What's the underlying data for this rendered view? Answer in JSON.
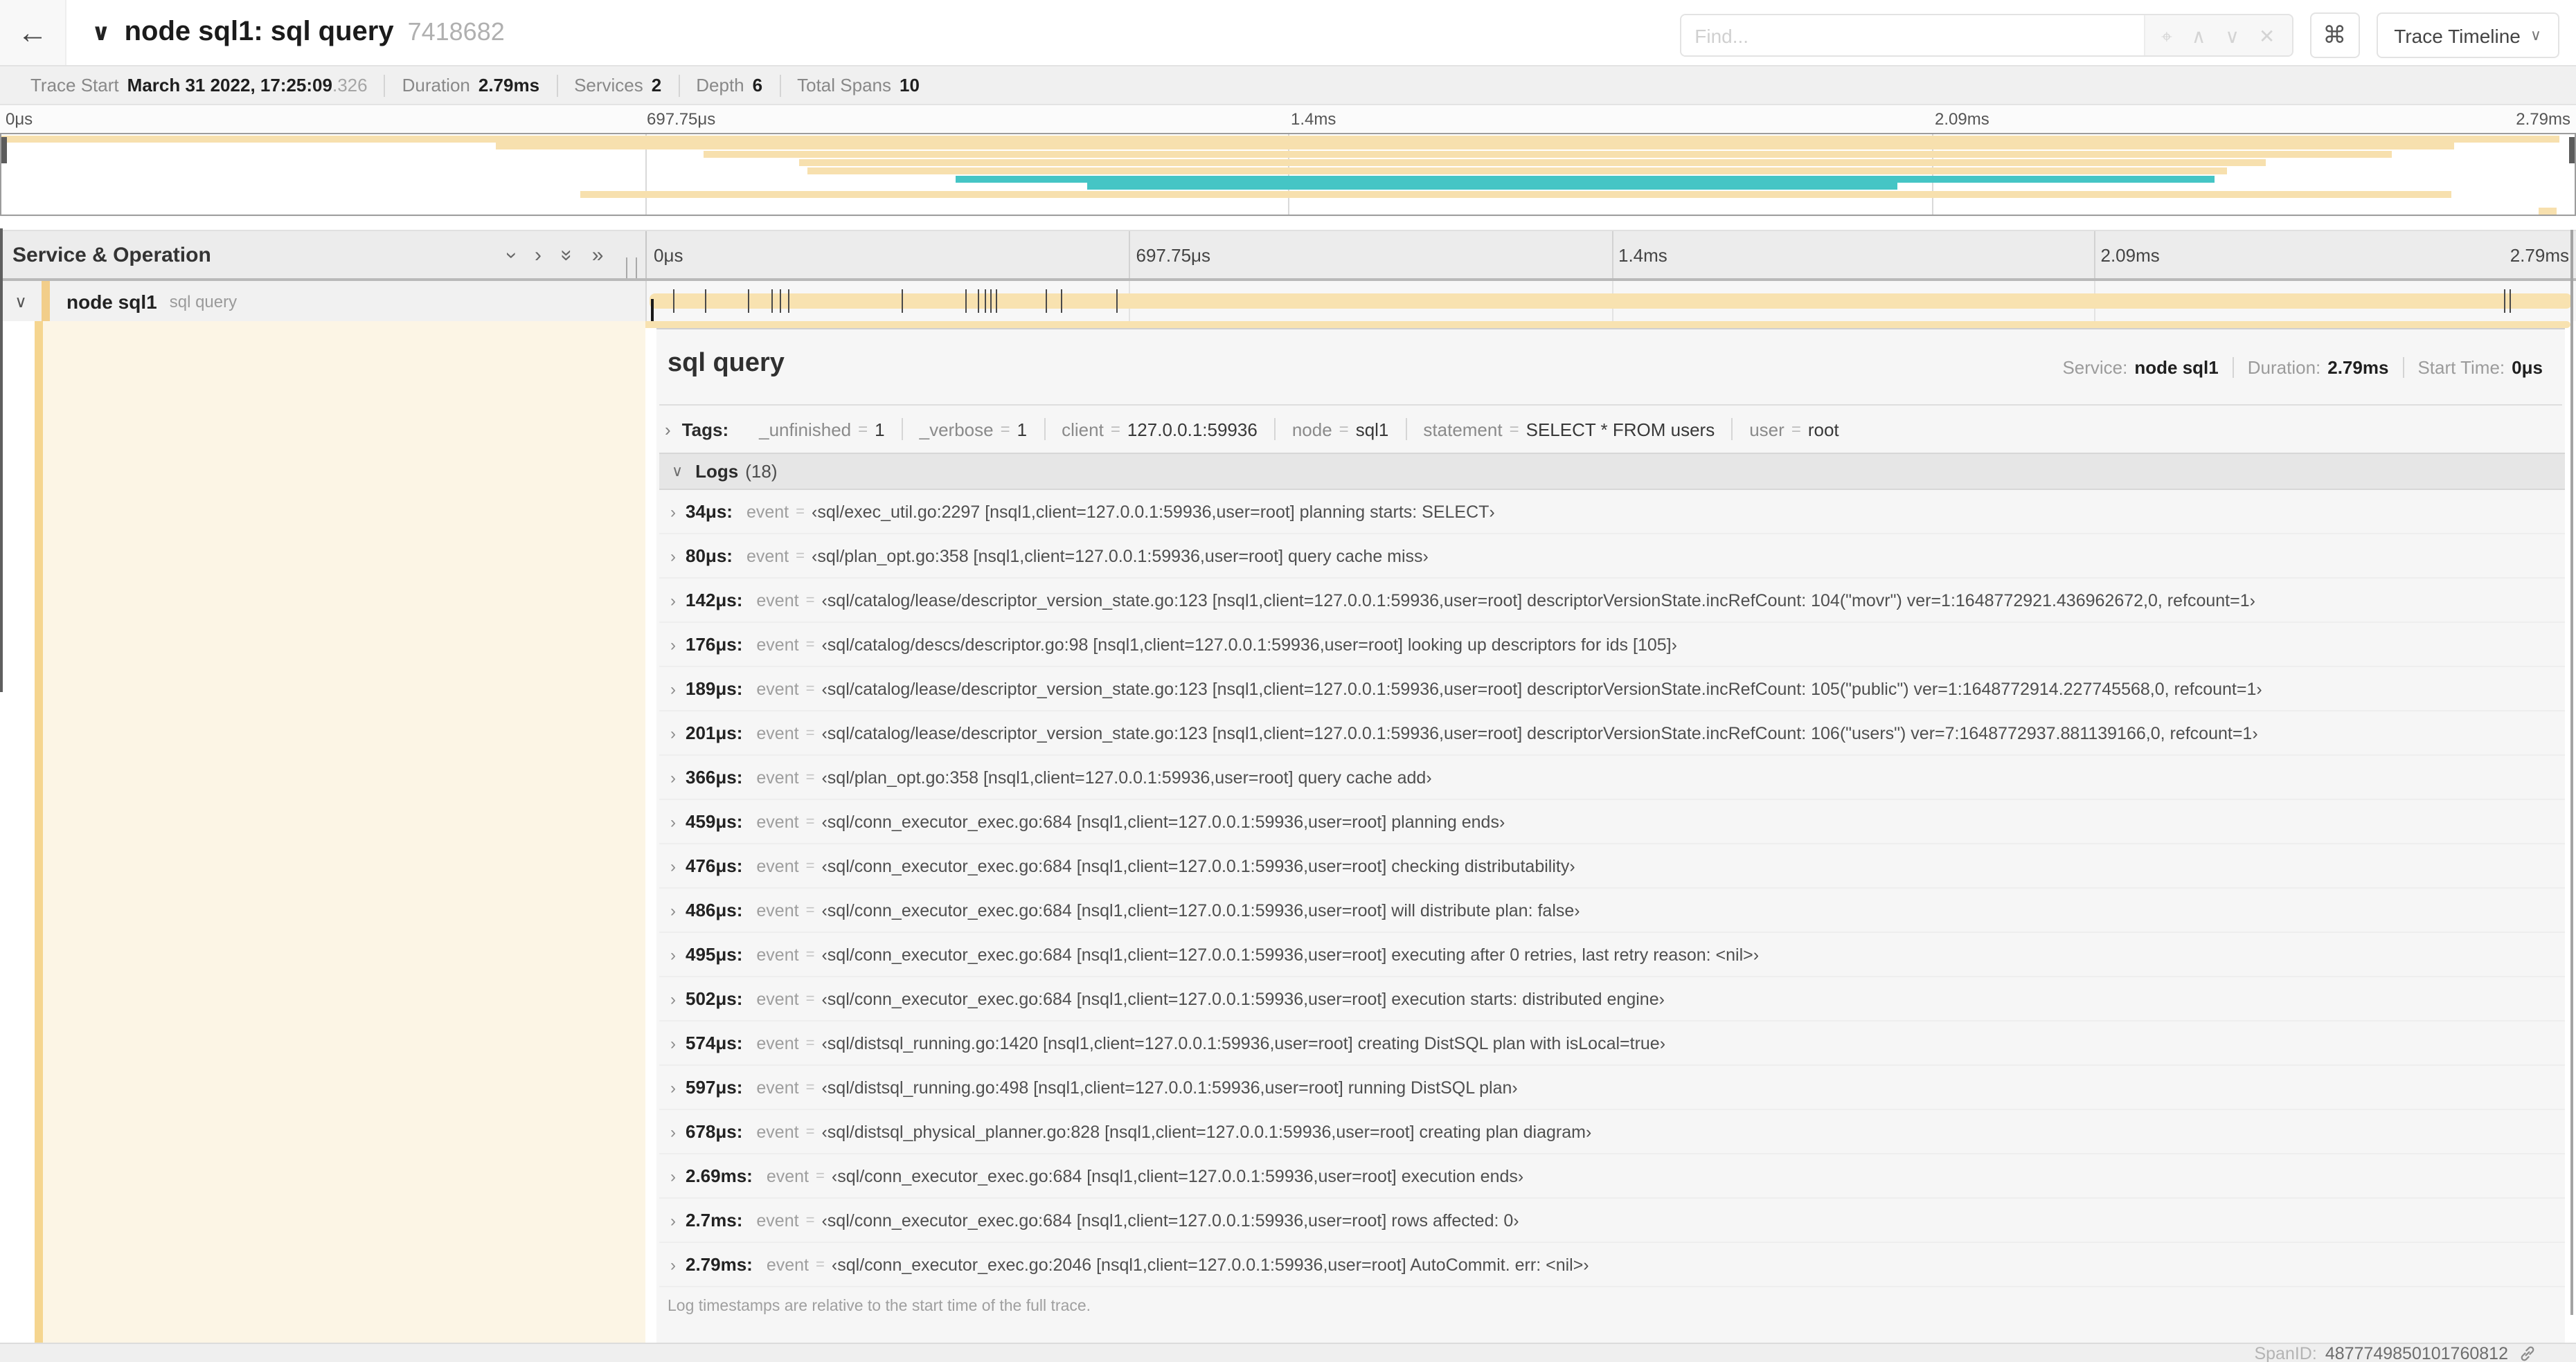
{
  "header": {
    "back_icon": "←",
    "collapse_icon": "∨",
    "title": "node sql1: sql query",
    "trace_id": "7418682",
    "find_placeholder": "Find...",
    "shortcut_button": "⌘",
    "view_select_label": "Trace Timeline",
    "view_select_chevron": "∨"
  },
  "summary": {
    "items": [
      {
        "label": "Trace Start",
        "value": "March 31 2022, 17:25:09",
        "suffix": ".326"
      },
      {
        "label": "Duration",
        "value": "2.79ms"
      },
      {
        "label": "Services",
        "value": "2"
      },
      {
        "label": "Depth",
        "value": "6"
      },
      {
        "label": "Total Spans",
        "value": "10"
      }
    ]
  },
  "minimap": {
    "ticks": [
      {
        "label": "0μs",
        "css": "left:4px"
      },
      {
        "label": "697.75μs",
        "css": "left:calc(25% + 2px)"
      },
      {
        "label": "1.4ms",
        "css": "left:calc(50% + 2px)"
      },
      {
        "label": "2.09ms",
        "css": "left:calc(75% + 2px)"
      },
      {
        "label": "2.79ms",
        "css": "right:4px"
      }
    ],
    "gridlines": [
      {
        "css": "left:25%"
      },
      {
        "css": "left:50%"
      },
      {
        "css": "left:75%"
      }
    ],
    "spans": [
      {
        "css": "top:1%;left:0%;width:99.4%;background:#F7E0AE"
      },
      {
        "css": "top:11%;left:19.2%;width:76.1%;background:#F7E0AE"
      },
      {
        "css": "top:21%;left:27.3%;width:65.6%;background:#F7E0AE"
      },
      {
        "css": "top:31%;left:31%;width:57%;background:#F7E0AE"
      },
      {
        "css": "top:41%;left:31.3%;width:55.2%;background:#F7E0AE"
      },
      {
        "css": "top:51%;left:37.1%;width:48.9%;background:#45C5C5"
      },
      {
        "css": "top:61%;left:42.2%;width:31.5%;background:#45C5C5"
      },
      {
        "css": "top:71%;left:22.5%;width:72.7%;background:#F7E0AE"
      },
      {
        "css": "top:91%;left:98.6%;width:0.7%;background:#F7E0AE"
      }
    ],
    "colors": {
      "span_default": "#F7E0AE",
      "span_alt": "#45C5C5"
    }
  },
  "timeline": {
    "column_header": "Service & Operation",
    "icons": [
      {
        "glyph": "›",
        "rot": true,
        "name": "collapse-all-icon"
      },
      {
        "glyph": "›",
        "rot": false,
        "name": "expand-one-icon"
      },
      {
        "glyph": "»",
        "rot": true,
        "name": "collapse-deep-icon"
      },
      {
        "glyph": "»",
        "rot": false,
        "name": "expand-all-icon"
      }
    ],
    "ticks": [
      {
        "label": "0μs",
        "css": "left:5px"
      },
      {
        "label": "697.75μs",
        "css": "left:calc(25% + 5px)"
      },
      {
        "label": "1.4ms",
        "css": "left:calc(50% + 5px)"
      },
      {
        "label": "2.09ms",
        "css": "left:calc(75% + 5px)"
      },
      {
        "label": "2.79ms",
        "css": "right:5px"
      }
    ],
    "gridlines": [
      {
        "css": "left:25%"
      },
      {
        "css": "left:50%"
      },
      {
        "css": "left:75%"
      }
    ],
    "row": {
      "chevron": "∨",
      "service": "node sql1",
      "operation": "sql query",
      "bar_color": "#F8E2B0",
      "log_ticks": [
        {
          "css": "left:1.22%"
        },
        {
          "css": "left:2.87%"
        },
        {
          "css": "left:5.09%"
        },
        {
          "css": "left:6.31%"
        },
        {
          "css": "left:6.77%"
        },
        {
          "css": "left:7.2%"
        },
        {
          "css": "left:13.12%"
        },
        {
          "css": "left:16.45%"
        },
        {
          "css": "left:17.06%"
        },
        {
          "css": "left:17.42%"
        },
        {
          "css": "left:17.74%"
        },
        {
          "css": "left:18.0%"
        },
        {
          "css": "left:20.57%"
        },
        {
          "css": "left:21.4%"
        },
        {
          "css": "left:24.3%"
        },
        {
          "css": "left:96.42%"
        },
        {
          "css": "left:96.77%"
        }
      ]
    }
  },
  "detail": {
    "operation": "sql query",
    "meta": [
      {
        "label": "Service:",
        "value": "node sql1"
      },
      {
        "label": "Duration:",
        "value": "2.79ms"
      },
      {
        "label": "Start Time:",
        "value": "0μs"
      }
    ],
    "tags_chevron": "›",
    "tags_label": "Tags:",
    "tags": [
      {
        "key": "_unfinished",
        "value": "1"
      },
      {
        "key": "_verbose",
        "value": "1"
      },
      {
        "key": "client",
        "value": "127.0.0.1:59936"
      },
      {
        "key": "node",
        "value": "sql1"
      },
      {
        "key": "statement",
        "value": "SELECT * FROM users"
      },
      {
        "key": "user",
        "value": "root"
      }
    ],
    "logs_chevron": "∨",
    "logs_label": "Logs",
    "logs_count": "(18)",
    "log_field": "event",
    "logs": [
      {
        "time": "34μs:",
        "field": "event",
        "value": "‹sql/exec_util.go:2297 [nsql1,client=127.0.0.1:59936,user=root] planning starts: SELECT›"
      },
      {
        "time": "80μs:",
        "field": "event",
        "value": "‹sql/plan_opt.go:358 [nsql1,client=127.0.0.1:59936,user=root] query cache miss›"
      },
      {
        "time": "142μs:",
        "field": "event",
        "value": "‹sql/catalog/lease/descriptor_version_state.go:123 [nsql1,client=127.0.0.1:59936,user=root] descriptorVersionState.incRefCount: 104(\"movr\") ver=1:1648772921.436962672,0, refcount=1›"
      },
      {
        "time": "176μs:",
        "field": "event",
        "value": "‹sql/catalog/descs/descriptor.go:98 [nsql1,client=127.0.0.1:59936,user=root] looking up descriptors for ids [105]›"
      },
      {
        "time": "189μs:",
        "field": "event",
        "value": "‹sql/catalog/lease/descriptor_version_state.go:123 [nsql1,client=127.0.0.1:59936,user=root] descriptorVersionState.incRefCount: 105(\"public\") ver=1:1648772914.227745568,0, refcount=1›"
      },
      {
        "time": "201μs:",
        "field": "event",
        "value": "‹sql/catalog/lease/descriptor_version_state.go:123 [nsql1,client=127.0.0.1:59936,user=root] descriptorVersionState.incRefCount: 106(\"users\") ver=7:1648772937.881139166,0, refcount=1›"
      },
      {
        "time": "366μs:",
        "field": "event",
        "value": "‹sql/plan_opt.go:358 [nsql1,client=127.0.0.1:59936,user=root] query cache add›"
      },
      {
        "time": "459μs:",
        "field": "event",
        "value": "‹sql/conn_executor_exec.go:684 [nsql1,client=127.0.0.1:59936,user=root] planning ends›"
      },
      {
        "time": "476μs:",
        "field": "event",
        "value": "‹sql/conn_executor_exec.go:684 [nsql1,client=127.0.0.1:59936,user=root] checking distributability›"
      },
      {
        "time": "486μs:",
        "field": "event",
        "value": "‹sql/conn_executor_exec.go:684 [nsql1,client=127.0.0.1:59936,user=root] will distribute plan: false›"
      },
      {
        "time": "495μs:",
        "field": "event",
        "value": "‹sql/conn_executor_exec.go:684 [nsql1,client=127.0.0.1:59936,user=root] executing after 0 retries, last retry reason: <nil>›"
      },
      {
        "time": "502μs:",
        "field": "event",
        "value": "‹sql/conn_executor_exec.go:684 [nsql1,client=127.0.0.1:59936,user=root] execution starts: distributed engine›"
      },
      {
        "time": "574μs:",
        "field": "event",
        "value": "‹sql/distsql_running.go:1420 [nsql1,client=127.0.0.1:59936,user=root] creating DistSQL plan with isLocal=true›"
      },
      {
        "time": "597μs:",
        "field": "event",
        "value": "‹sql/distsql_running.go:498 [nsql1,client=127.0.0.1:59936,user=root] running DistSQL plan›"
      },
      {
        "time": "678μs:",
        "field": "event",
        "value": "‹sql/distsql_physical_planner.go:828 [nsql1,client=127.0.0.1:59936,user=root] creating plan diagram›"
      },
      {
        "time": "2.69ms:",
        "field": "event",
        "value": "‹sql/conn_executor_exec.go:684 [nsql1,client=127.0.0.1:59936,user=root] execution ends›"
      },
      {
        "time": "2.7ms:",
        "field": "event",
        "value": "‹sql/conn_executor_exec.go:684 [nsql1,client=127.0.0.1:59936,user=root] rows affected: 0›"
      },
      {
        "time": "2.79ms:",
        "field": "event",
        "value": "‹sql/conn_executor_exec.go:2046 [nsql1,client=127.0.0.1:59936,user=root] AutoCommit. err: <nil>›"
      }
    ],
    "footnote": "Log timestamps are relative to the start time of the full trace.",
    "span_id_label": "SpanID:",
    "span_id": "4877749850101760812"
  }
}
